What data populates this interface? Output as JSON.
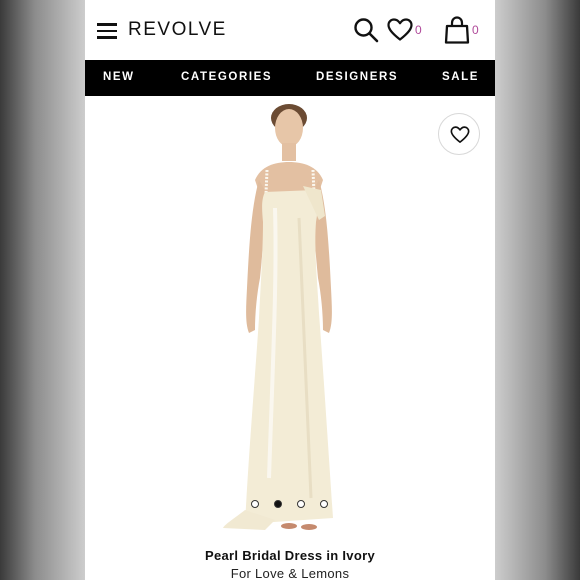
{
  "header": {
    "logo": "REVOLVE",
    "icons": [
      "menu-icon",
      "search-icon",
      "heart-icon",
      "bag-icon"
    ],
    "wishlist_count": "0",
    "bag_count": "0"
  },
  "nav": {
    "items": [
      "NEW",
      "CATEGORIES",
      "DESIGNERS",
      "SALE"
    ]
  },
  "carousel": {
    "slides": 4,
    "active_index": 1
  },
  "product": {
    "name": "Pearl Bridal Dress in Ivory",
    "brand": "For Love & Lemons"
  },
  "colors": {
    "nav_background": "#000000",
    "count_accent": "#b04a9a",
    "dress": "#f3ecd6"
  }
}
